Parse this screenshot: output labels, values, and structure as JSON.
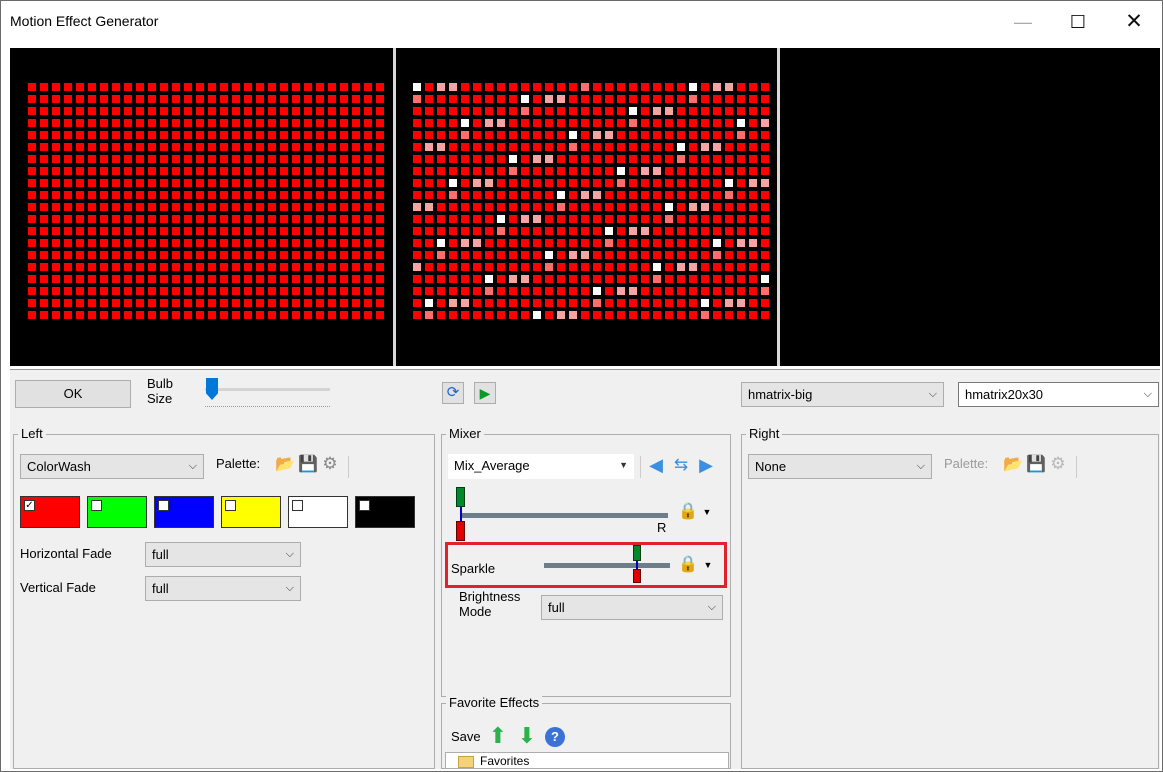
{
  "window": {
    "title": "Motion Effect Generator",
    "minimize": "—",
    "maximize": "☐",
    "close": "✕"
  },
  "toolbar": {
    "ok_label": "OK",
    "bulb_size_label": "Bulb\nSize",
    "bulb_size_value": 0.05,
    "model_select": "hmatrix-big",
    "submodel_select": "hmatrix20x30"
  },
  "left": {
    "title": "Left",
    "effect": "ColorWash",
    "palette_label": "Palette:",
    "palette_icons": [
      "open-folder-icon",
      "save-disk-icon",
      "gear-icon"
    ],
    "colors": [
      {
        "hex": "#ff0000",
        "checked": true
      },
      {
        "hex": "#00ff00",
        "checked": false
      },
      {
        "hex": "#0000ff",
        "checked": false
      },
      {
        "hex": "#ffff00",
        "checked": false
      },
      {
        "hex": "#ffffff",
        "checked": false
      },
      {
        "hex": "#000000",
        "checked": false
      }
    ],
    "horizontal_fade_label": "Horizontal Fade",
    "horizontal_fade_value": "full",
    "vertical_fade_label": "Vertical Fade",
    "vertical_fade_value": "full"
  },
  "mixer": {
    "title": "Mixer",
    "mode": "Mix_Average",
    "r_label": "R",
    "sparkle_label": "Sparkle",
    "brightness_label": "Brightness\nMode",
    "brightness_value": "full",
    "arrow_icons": [
      "left-arrow-icon",
      "swap-arrows-icon",
      "right-arrow-icon"
    ]
  },
  "favorites": {
    "title": "Favorite Effects",
    "save_label": "Save",
    "tree_item": "Favorites"
  },
  "right": {
    "title": "Right",
    "effect": "None",
    "palette_label": "Palette:"
  }
}
